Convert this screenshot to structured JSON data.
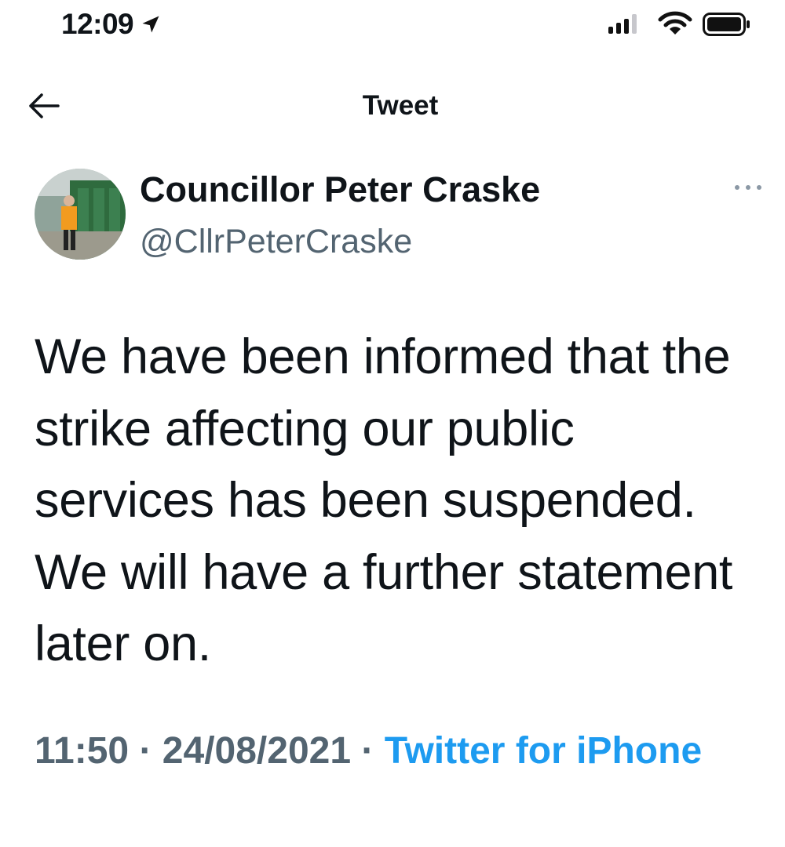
{
  "status_bar": {
    "time": "12:09",
    "location_icon": "location-arrow-icon",
    "signal_icon": "cellular-signal-icon",
    "wifi_icon": "wifi-icon",
    "battery_icon": "battery-icon"
  },
  "header": {
    "title": "Tweet",
    "back_icon": "back-arrow-icon"
  },
  "tweet": {
    "author": {
      "name": "Councillor Peter Craske",
      "handle": "@CllrPeterCraske"
    },
    "more_icon": "more-dots-icon",
    "text": "We have been informed that the strike affecting our public services has been suspended. We will have a further statement later on.",
    "time": "11:50",
    "separator": "·",
    "date": "24/08/2021",
    "source": "Twitter for iPhone"
  },
  "colors": {
    "text": "#0f1419",
    "secondary": "#536471",
    "link": "#1d9bf0"
  }
}
